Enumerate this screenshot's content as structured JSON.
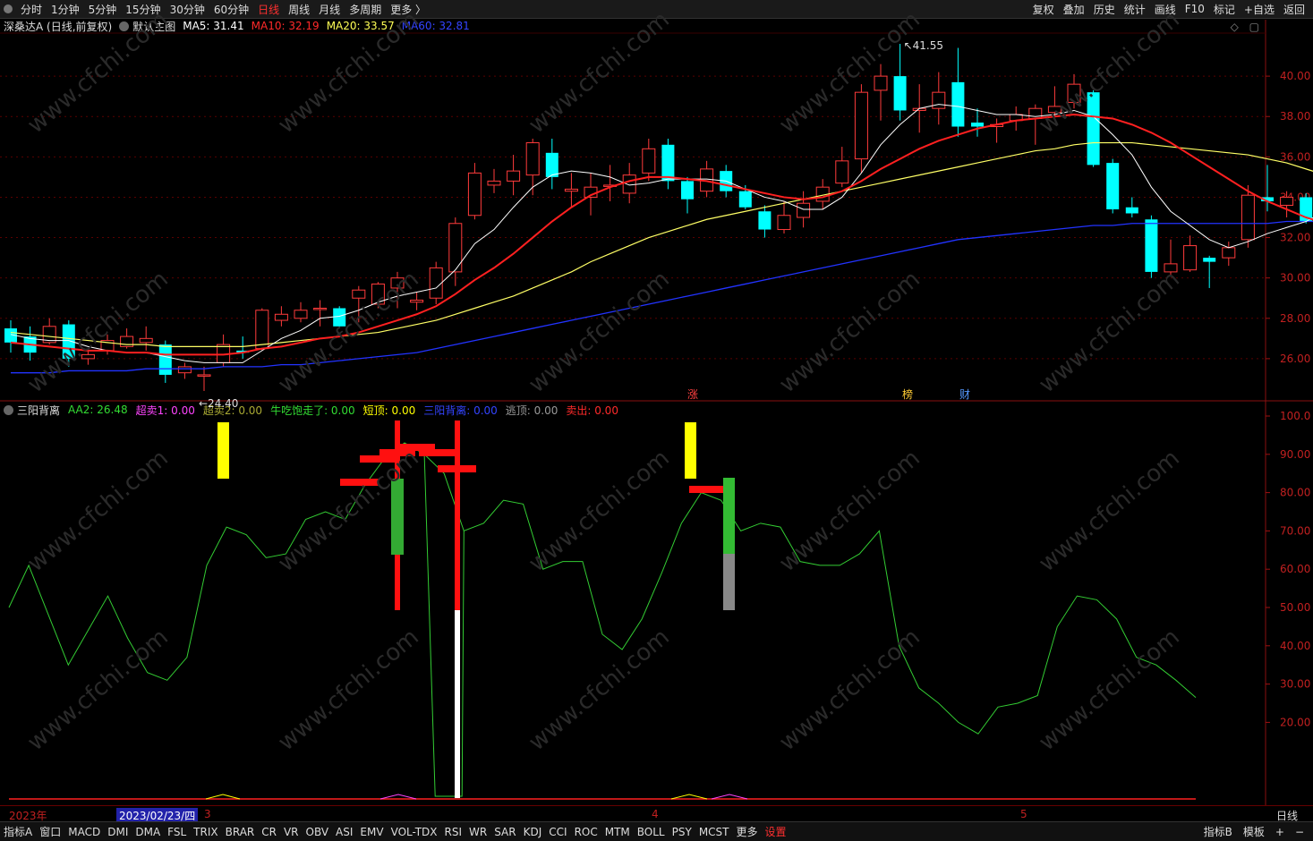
{
  "topbar": {
    "periods": [
      "分时",
      "1分钟",
      "5分钟",
      "15分钟",
      "30分钟",
      "60分钟",
      "日线",
      "周线",
      "月线",
      "多周期",
      "更多 〉"
    ],
    "active_period": "日线",
    "right_buttons": [
      "复权",
      "叠加",
      "历史",
      "统计",
      "画线",
      "F10",
      "标记",
      "+自选",
      "返回"
    ]
  },
  "main": {
    "stock": "深桑达A (日线,前复权)",
    "template": "默认主图",
    "ma5": "MA5: 31.41",
    "ma10": "MA10: 32.19",
    "ma20": "MA20: 33.57",
    "ma60": "MA60: 32.81",
    "high_label": "41.55",
    "low_label": "24.40",
    "markers": [
      "涨",
      "榜",
      "财"
    ],
    "price_ticks": [
      "40.00",
      "38.00",
      "36.00",
      "34.00",
      "32.00",
      "30.00",
      "28.00",
      "26.00"
    ],
    "colors": {
      "up": "#ff3b3b",
      "down": "#00ffff",
      "ma5": "#ffffff",
      "ma10": "#ff2020",
      "ma20": "#ffff66",
      "ma60": "#2233ff"
    }
  },
  "indicator": {
    "name": "三阳背离",
    "aa2": "AA2: 26.48",
    "chaomai1": "超卖1: 0.00",
    "chaomai2": "超卖2: 0.00",
    "niuchi": "牛吃饱走了: 0.00",
    "duanding": "短顶: 0.00",
    "sanyang": "三阳背离: 0.00",
    "taoding": "逃顶: 0.00",
    "maichu": "卖出: 0.00",
    "ticks": [
      "100.0",
      "90.00",
      "80.00",
      "70.00",
      "60.00",
      "50.00",
      "40.00",
      "30.00",
      "20.00"
    ]
  },
  "axis": {
    "year": "2023年",
    "date": "2023/02/23/四",
    "months": [
      "3",
      "4",
      "5"
    ],
    "right_label": "日线"
  },
  "bottombar": {
    "items": [
      "指标A",
      "窗口",
      "MACD",
      "DMI",
      "DMA",
      "FSL",
      "TRIX",
      "BRAR",
      "CR",
      "VR",
      "OBV",
      "ASI",
      "EMV",
      "VOL-TDX",
      "RSI",
      "WR",
      "SAR",
      "KDJ",
      "CCI",
      "ROC",
      "MTM",
      "BOLL",
      "PSY",
      "MCST",
      "更多",
      "设置"
    ],
    "active": "设置",
    "right_items": [
      "指标B",
      "模板",
      "+",
      "−"
    ]
  },
  "watermark": "www.cfchi.com",
  "chart_data": {
    "type": "candlestick",
    "price_range": [
      24.0,
      42.0
    ],
    "candles": [
      [
        27.5,
        26.8,
        27.9,
        26.3
      ],
      [
        27.1,
        26.3,
        27.6,
        25.9
      ],
      [
        26.8,
        27.6,
        28.0,
        26.7
      ],
      [
        27.7,
        26.0,
        27.9,
        25.6
      ],
      [
        26.0,
        26.2,
        26.5,
        25.7
      ],
      [
        26.4,
        26.9,
        27.2,
        26.2
      ],
      [
        26.6,
        27.1,
        27.5,
        26.5
      ],
      [
        26.8,
        27.0,
        27.6,
        26.4
      ],
      [
        26.7,
        25.2,
        26.9,
        24.8
      ],
      [
        25.3,
        25.6,
        25.8,
        25.0
      ],
      [
        25.2,
        25.2,
        25.6,
        24.4
      ],
      [
        25.8,
        26.7,
        27.2,
        25.6
      ],
      [
        26.4,
        26.3,
        27.1,
        26.0
      ],
      [
        26.5,
        28.4,
        28.5,
        26.4
      ],
      [
        27.9,
        28.2,
        28.6,
        27.6
      ],
      [
        28.0,
        28.4,
        28.8,
        27.8
      ],
      [
        28.5,
        28.5,
        28.9,
        27.6
      ],
      [
        28.5,
        27.6,
        28.6,
        27.5
      ],
      [
        29.0,
        29.4,
        29.6,
        27.8
      ],
      [
        28.7,
        29.7,
        29.8,
        28.5
      ],
      [
        29.5,
        30.0,
        30.3,
        28.5
      ],
      [
        28.8,
        28.9,
        29.3,
        28.4
      ],
      [
        29.0,
        30.5,
        30.8,
        28.7
      ],
      [
        30.3,
        32.7,
        33.0,
        29.6
      ],
      [
        33.1,
        35.2,
        35.7,
        32.9
      ],
      [
        34.6,
        34.8,
        35.4,
        34.2
      ],
      [
        34.8,
        35.3,
        36.1,
        34.1
      ],
      [
        35.1,
        36.7,
        36.9,
        34.1
      ],
      [
        36.2,
        35.0,
        36.9,
        34.4
      ],
      [
        34.3,
        34.4,
        35.2,
        33.5
      ],
      [
        34.0,
        34.5,
        35.2,
        33.1
      ],
      [
        34.6,
        34.6,
        35.6,
        33.8
      ],
      [
        34.2,
        35.1,
        35.7,
        33.7
      ],
      [
        35.2,
        36.4,
        36.9,
        34.8
      ],
      [
        36.6,
        34.8,
        36.9,
        34.4
      ],
      [
        34.8,
        33.9,
        35.0,
        33.2
      ],
      [
        34.3,
        35.4,
        35.8,
        34.0
      ],
      [
        35.3,
        34.3,
        35.6,
        34.0
      ],
      [
        34.3,
        33.5,
        34.6,
        33.4
      ],
      [
        33.3,
        32.4,
        33.6,
        32.0
      ],
      [
        32.4,
        33.1,
        33.8,
        32.2
      ],
      [
        33.0,
        33.7,
        34.3,
        32.5
      ],
      [
        33.8,
        34.5,
        34.9,
        33.4
      ],
      [
        34.7,
        35.8,
        36.5,
        34.5
      ],
      [
        35.9,
        39.2,
        39.6,
        35.2
      ],
      [
        39.3,
        40.0,
        40.6,
        37.8
      ],
      [
        40.0,
        38.3,
        41.6,
        37.8
      ],
      [
        38.3,
        38.4,
        39.6,
        37.2
      ],
      [
        38.4,
        39.2,
        40.2,
        37.6
      ],
      [
        39.7,
        37.5,
        41.4,
        37.0
      ],
      [
        37.7,
        37.5,
        38.4,
        37.0
      ],
      [
        37.5,
        37.6,
        37.9,
        36.7
      ],
      [
        37.8,
        38.1,
        38.5,
        37.3
      ],
      [
        37.9,
        38.4,
        38.6,
        36.6
      ],
      [
        38.2,
        38.5,
        39.5,
        38.0
      ],
      [
        38.7,
        39.6,
        40.1,
        38.4
      ],
      [
        39.2,
        35.6,
        39.3,
        35.5
      ],
      [
        35.7,
        33.4,
        35.9,
        33.2
      ],
      [
        33.5,
        33.2,
        34.0,
        33.0
      ],
      [
        32.9,
        30.3,
        33.1,
        30.0
      ],
      [
        30.3,
        30.7,
        31.9,
        30.1
      ],
      [
        30.4,
        31.6,
        32.1,
        30.3
      ],
      [
        31.0,
        30.8,
        31.1,
        29.5
      ],
      [
        31.0,
        31.5,
        31.8,
        30.6
      ],
      [
        31.9,
        34.1,
        34.6,
        31.5
      ],
      [
        34.0,
        33.8,
        35.6,
        33.3
      ],
      [
        33.6,
        34.0,
        34.3,
        33.0
      ],
      [
        34.0,
        32.8,
        34.2,
        32.7
      ],
      [
        32.7,
        31.9,
        33.4,
        31.8
      ],
      [
        31.7,
        32.0,
        32.6,
        30.1
      ],
      [
        31.8,
        30.7,
        32.3,
        30.6
      ],
      [
        30.6,
        30.4,
        30.8,
        30.1
      ]
    ],
    "ma5": [
      27.2,
      27.0,
      26.9,
      26.9,
      26.6,
      26.4,
      26.3,
      26.3,
      26.1,
      25.9,
      25.8,
      25.8,
      25.8,
      26.4,
      27.0,
      27.4,
      28.0,
      28.1,
      28.4,
      28.8,
      29.1,
      29.3,
      29.5,
      30.4,
      31.7,
      32.4,
      33.5,
      34.5,
      35.1,
      35.3,
      35.2,
      35.0,
      34.6,
      34.7,
      34.9,
      34.9,
      34.9,
      34.8,
      34.4,
      34.0,
      33.8,
      33.4,
      33.4,
      34.0,
      35.2,
      36.6,
      37.6,
      38.4,
      38.6,
      38.5,
      38.3,
      38.1,
      38.1,
      38.0,
      38.1,
      38.3,
      38.0,
      37.1,
      36.1,
      34.5,
      33.3,
      32.6,
      31.9,
      31.5,
      31.8,
      32.2,
      32.5,
      32.8,
      33.3,
      33.0,
      32.4,
      31.6
    ],
    "ma10": [
      26.8,
      26.7,
      26.6,
      26.5,
      26.4,
      26.4,
      26.3,
      26.3,
      26.2,
      26.2,
      26.2,
      26.2,
      26.3,
      26.5,
      26.6,
      26.8,
      27.0,
      27.1,
      27.3,
      27.6,
      27.9,
      28.2,
      28.6,
      29.2,
      29.9,
      30.5,
      31.2,
      32.0,
      32.8,
      33.5,
      34.1,
      34.5,
      34.8,
      35.0,
      35.0,
      34.9,
      34.8,
      34.6,
      34.4,
      34.2,
      34.0,
      33.9,
      34.0,
      34.3,
      34.8,
      35.4,
      35.9,
      36.4,
      36.8,
      37.1,
      37.4,
      37.6,
      37.8,
      37.9,
      38.0,
      38.1,
      38.0,
      37.9,
      37.6,
      37.2,
      36.7,
      36.1,
      35.5,
      34.9,
      34.3,
      33.8,
      33.4,
      33.0,
      32.7,
      32.4,
      32.3,
      32.2
    ],
    "ma20": [
      27.3,
      27.2,
      27.1,
      27.0,
      26.9,
      26.8,
      26.7,
      26.7,
      26.6,
      26.6,
      26.6,
      26.6,
      26.6,
      26.7,
      26.8,
      26.9,
      27.0,
      27.1,
      27.2,
      27.3,
      27.5,
      27.7,
      27.9,
      28.2,
      28.5,
      28.8,
      29.1,
      29.5,
      29.9,
      30.3,
      30.8,
      31.2,
      31.6,
      32.0,
      32.3,
      32.6,
      32.9,
      33.1,
      33.3,
      33.5,
      33.7,
      33.9,
      34.1,
      34.3,
      34.5,
      34.7,
      34.9,
      35.1,
      35.3,
      35.5,
      35.7,
      35.9,
      36.1,
      36.3,
      36.4,
      36.6,
      36.7,
      36.7,
      36.7,
      36.6,
      36.5,
      36.4,
      36.3,
      36.2,
      36.1,
      35.9,
      35.7,
      35.4,
      35.1,
      34.7,
      34.2,
      33.6
    ],
    "ma60": [
      25.3,
      25.3,
      25.3,
      25.4,
      25.4,
      25.4,
      25.4,
      25.5,
      25.5,
      25.5,
      25.5,
      25.6,
      25.6,
      25.6,
      25.7,
      25.7,
      25.8,
      25.9,
      26.0,
      26.1,
      26.2,
      26.3,
      26.5,
      26.7,
      26.9,
      27.1,
      27.3,
      27.5,
      27.7,
      27.9,
      28.1,
      28.3,
      28.5,
      28.7,
      28.9,
      29.1,
      29.3,
      29.5,
      29.7,
      29.9,
      30.1,
      30.3,
      30.5,
      30.7,
      30.9,
      31.1,
      31.3,
      31.5,
      31.7,
      31.9,
      32.0,
      32.1,
      32.2,
      32.3,
      32.4,
      32.5,
      32.6,
      32.6,
      32.7,
      32.7,
      32.7,
      32.7,
      32.7,
      32.7,
      32.7,
      32.7,
      32.8,
      32.8,
      32.8,
      32.8,
      32.8,
      32.81
    ],
    "indicator_range": [
      0,
      100
    ],
    "aa2": [
      50,
      61,
      48,
      35,
      44,
      53,
      42,
      33,
      31,
      37,
      61,
      71,
      69,
      63,
      64,
      73,
      75,
      73,
      82,
      89,
      93,
      90,
      85,
      70,
      72,
      78,
      77,
      60,
      62,
      62,
      43,
      39,
      47,
      59,
      72,
      80,
      78,
      70,
      72,
      71,
      62,
      61,
      61,
      64,
      70,
      40,
      29,
      25,
      20,
      17,
      24,
      25,
      27,
      45,
      53,
      52,
      47,
      37,
      35,
      31,
      26.48
    ],
    "aa2_start_index": 0
  }
}
